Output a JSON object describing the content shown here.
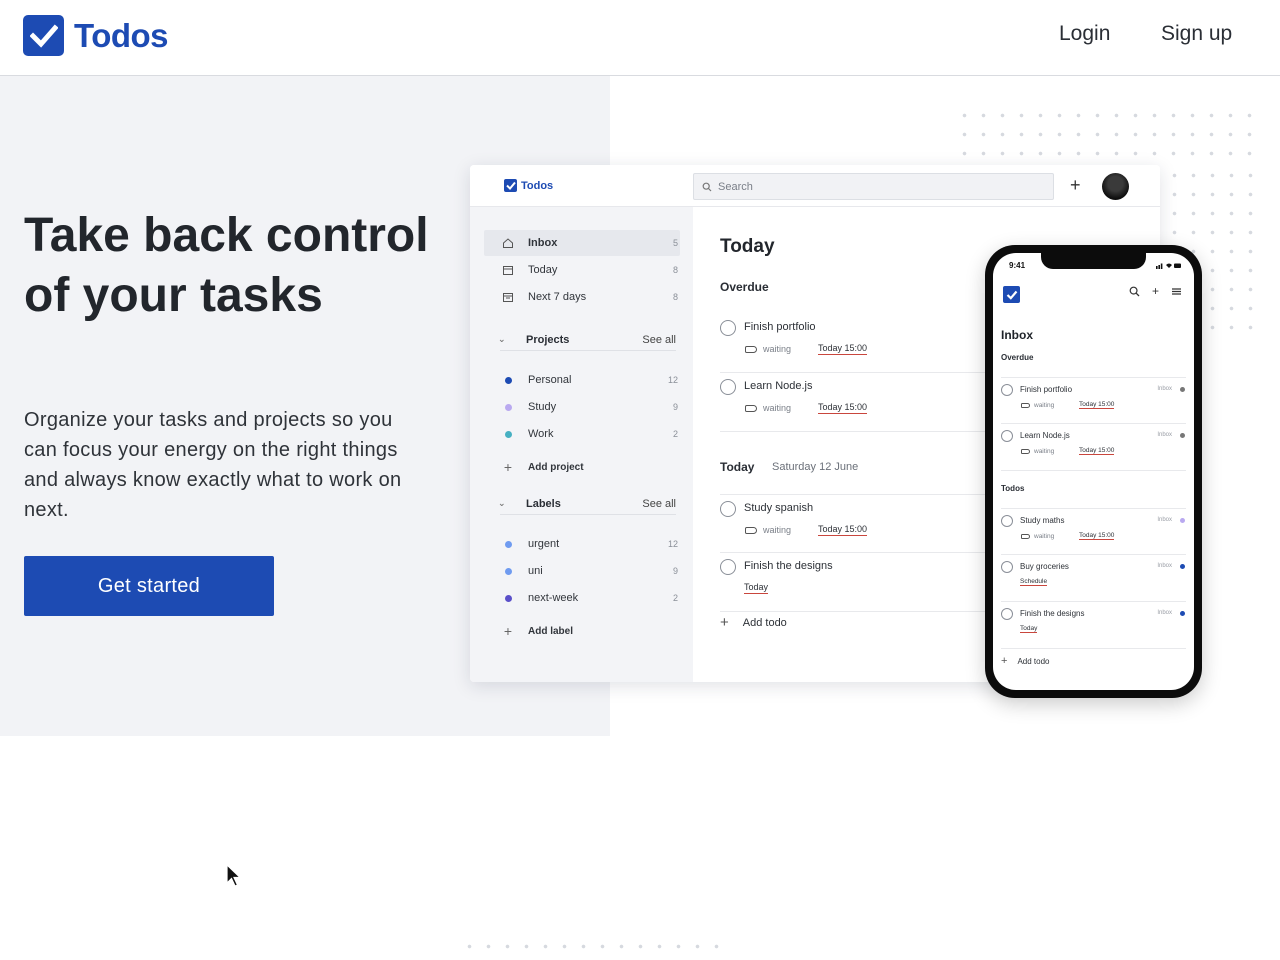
{
  "header": {
    "brand": "Todos",
    "nav": {
      "login": "Login",
      "signup": "Sign up"
    }
  },
  "hero": {
    "title": "Take back control of your tasks",
    "subtitle": "Organize your tasks and projects so you can focus your energy on the right things and always know exactly what to work on next.",
    "cta": "Get started"
  },
  "colors": {
    "brand": "#1d4bb3",
    "hero_bg": "#f2f3f6",
    "date_underline": "#c9463d"
  },
  "desktop": {
    "brand": "Todos",
    "search_placeholder": "Search",
    "nav": [
      {
        "icon": "home-icon",
        "label": "Inbox",
        "count": "5"
      },
      {
        "icon": "calendar-today-icon",
        "label": "Today",
        "count": "8"
      },
      {
        "icon": "calendar-week-icon",
        "label": "Next 7 days",
        "count": "8"
      }
    ],
    "projects_heading": "Projects",
    "projects_see_all": "See all",
    "projects": [
      {
        "label": "Personal",
        "count": "12",
        "color": "#1d4bb3"
      },
      {
        "label": "Study",
        "count": "9",
        "color": "#b9a9f0"
      },
      {
        "label": "Work",
        "count": "2",
        "color": "#46b0c2"
      }
    ],
    "add_project": "Add project",
    "labels_heading": "Labels",
    "labels_see_all": "See all",
    "labels": [
      {
        "label": "urgent",
        "count": "12",
        "color": "#6f9bf0"
      },
      {
        "label": "uni",
        "count": "9",
        "color": "#6f9bf0"
      },
      {
        "label": "next-week",
        "count": "2",
        "color": "#5a4fc9"
      }
    ],
    "add_label": "Add label",
    "main": {
      "title": "Today",
      "overdue_heading": "Overdue",
      "overdue": [
        {
          "title": "Finish portfolio",
          "tag": "waiting",
          "date": "Today 15:00"
        },
        {
          "title": "Learn Node.js",
          "tag": "waiting",
          "date": "Today 15:00"
        }
      ],
      "today_heading": "Today",
      "today_date": "Saturday 12 June",
      "today": [
        {
          "title": "Study spanish",
          "tag": "waiting",
          "date": "Today 15:00"
        },
        {
          "title": "Finish the designs",
          "tag": "",
          "date": "Today"
        }
      ],
      "add_todo": "Add todo"
    }
  },
  "phone": {
    "time": "9:41",
    "title": "Inbox",
    "overdue_heading": "Overdue",
    "overdue": [
      {
        "title": "Finish portfolio",
        "project": "Inbox",
        "tag": "waiting",
        "date": "Today 15:00",
        "dot": "#777777"
      },
      {
        "title": "Learn Node.js",
        "project": "Inbox",
        "tag": "waiting",
        "date": "Today 15:00",
        "dot": "#777777"
      }
    ],
    "todos_heading": "Todos",
    "todos": [
      {
        "title": "Study maths",
        "project": "Inbox",
        "tag": "waiting",
        "date": "Today 15:00",
        "dot": "#b9a9f0"
      },
      {
        "title": "Buy groceries",
        "project": "Inbox",
        "tag": "",
        "date": "Schedule",
        "dot": "#1d4bb3"
      },
      {
        "title": "Finish the designs",
        "project": "Inbox",
        "tag": "",
        "date": "Today",
        "dot": "#1d4bb3"
      }
    ],
    "add_todo": "Add todo"
  }
}
